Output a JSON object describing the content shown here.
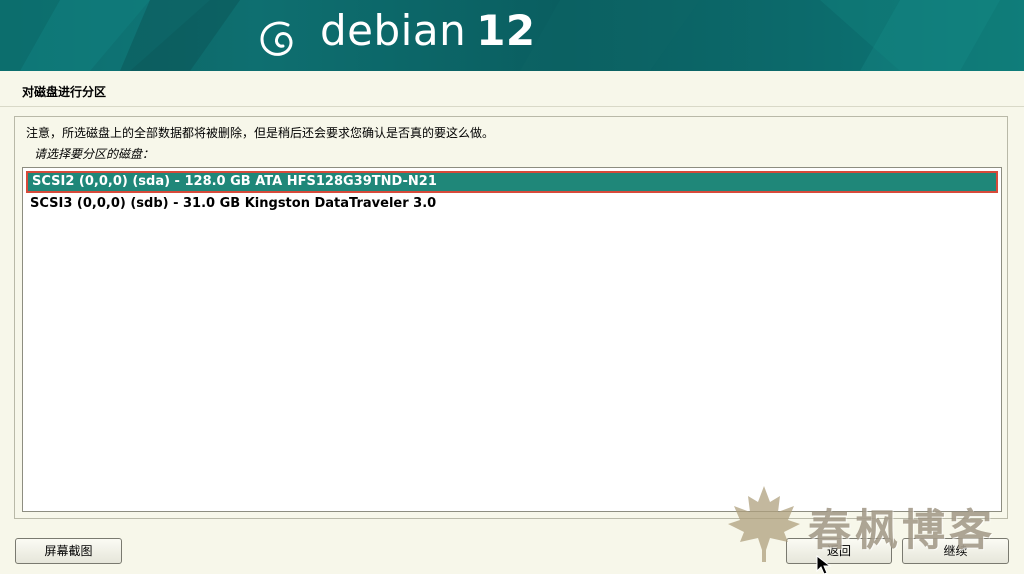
{
  "banner": {
    "logo_text": "debian",
    "version": "12",
    "logo_icon": "debian-swirl-icon"
  },
  "step": {
    "title": "对磁盘进行分区"
  },
  "content": {
    "warning": "注意，所选磁盘上的全部数据都将被删除，但是稍后还会要求您确认是否真的要这么做。",
    "prompt": "请选择要分区的磁盘："
  },
  "disks": [
    {
      "label": "SCSI2 (0,0,0) (sda) - 128.0 GB ATA HFS128G39TND-N21",
      "selected": true
    },
    {
      "label": "SCSI3 (0,0,0) (sdb) - 31.0 GB Kingston DataTraveler 3.0",
      "selected": false
    }
  ],
  "buttons": {
    "screenshot": "屏幕截图",
    "back": "返回",
    "continue": "继续"
  },
  "watermark": {
    "text": "春枫博客",
    "icon": "maple-leaf-icon"
  },
  "colors": {
    "banner": "#0b5f60",
    "selection": "#1f8779",
    "selection_border": "#d74a3a",
    "background": "#f7f7ea"
  }
}
